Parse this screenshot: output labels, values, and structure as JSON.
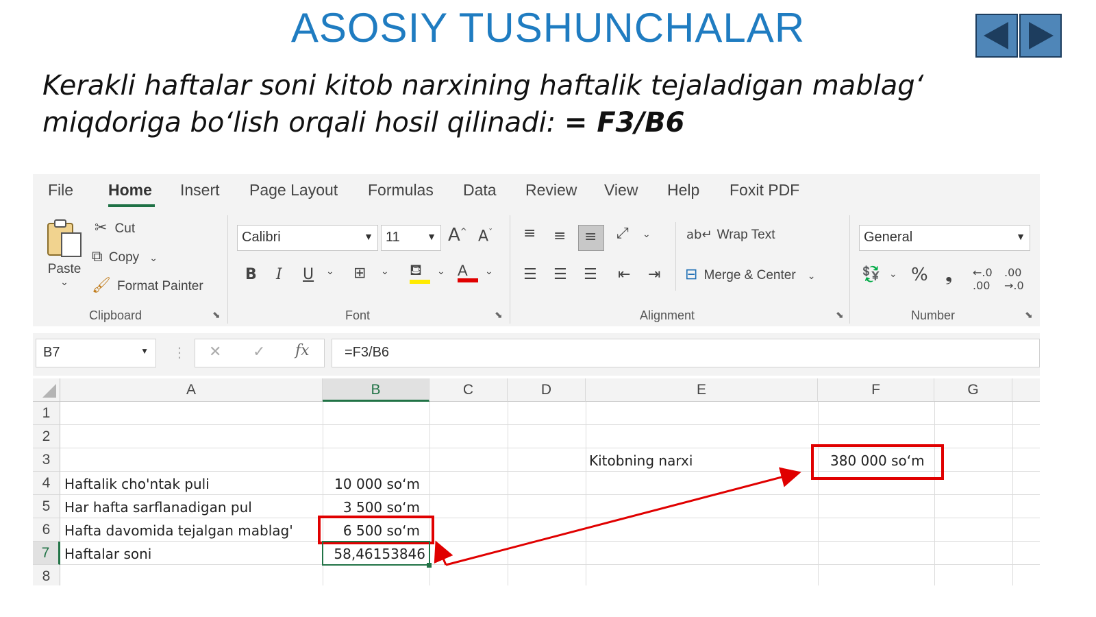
{
  "slide": {
    "title": "ASOSIY TUSHUNCHALAR",
    "subtitle_text": "Kerakli haftalar soni kitob narxining haftalik tejaladigan mablag‘ miqdoriga  bo‘lish orqali hosil qilinadi: ",
    "subtitle_formula": "= F3/B6",
    "nav": {
      "prev_icon": "left-triangle-icon",
      "next_icon": "right-triangle-icon",
      "color": "#4f86b8"
    }
  },
  "excel": {
    "menu": [
      "File",
      "Home",
      "Insert",
      "Page Layout",
      "Formulas",
      "Data",
      "Review",
      "View",
      "Help",
      "Foxit PDF"
    ],
    "active_tab": "Home",
    "clipboard": {
      "paste": "Paste",
      "cut": "Cut",
      "copy": "Copy",
      "format_painter": "Format Painter",
      "group": "Clipboard"
    },
    "font": {
      "name": "Calibri",
      "size": "11",
      "bold": "B",
      "italic": "I",
      "underline": "U",
      "group": "Font",
      "grow": "A",
      "shrink": "A",
      "font_color_letter": "A"
    },
    "alignment": {
      "wrap_text": "Wrap Text",
      "merge_center": "Merge & Center",
      "group": "Alignment"
    },
    "number": {
      "format": "General",
      "percent": "%",
      "comma": "❟",
      "group": "Number"
    },
    "name_box": "B7",
    "formula": "=F3/B6",
    "fx": "fx",
    "columns": [
      "A",
      "B",
      "C",
      "D",
      "E",
      "F",
      "G"
    ],
    "rows": [
      "1",
      "2",
      "3",
      "4",
      "5",
      "6",
      "7",
      "8"
    ],
    "cells": {
      "E3": "Kitobning narxi",
      "F3": "380 000 so‘m",
      "A4": "Haftalik cho'ntak puli",
      "B4": "10 000 so‘m",
      "A5": "Har hafta sarflanadigan pul",
      "B5": "3 500 so‘m",
      "A6": "Hafta davomida tejalgan mablag'",
      "B6": "6 500 so‘m",
      "A7": "Haftalar soni",
      "B7": "58,46153846"
    },
    "colors": {
      "accent_green": "#217346",
      "highlight_red": "#e00000",
      "title_blue": "#1f7cc1"
    }
  }
}
